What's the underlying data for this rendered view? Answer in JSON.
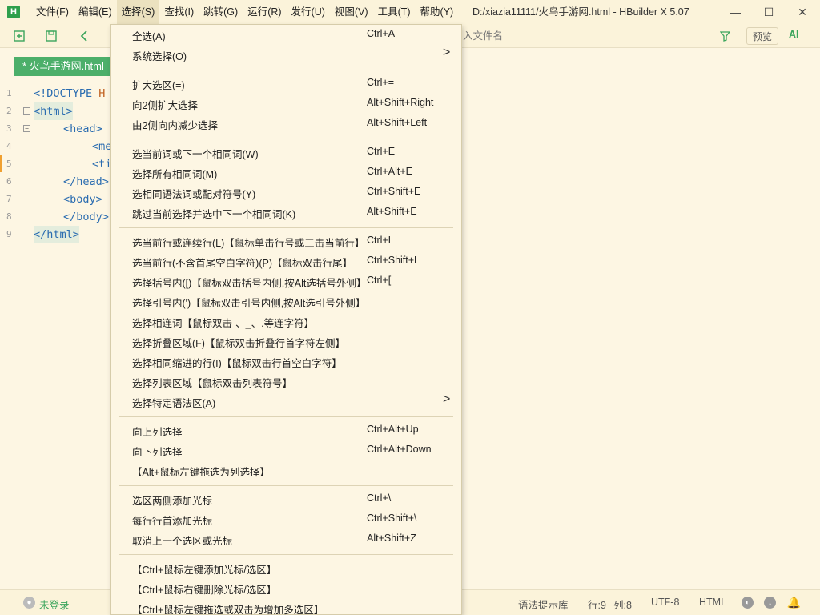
{
  "app": {
    "logo": "H",
    "window_title": "D:/xiazia11111/火鸟手游网.html - HBuilder X 5.07"
  },
  "menubar": [
    "文件(F)",
    "编辑(E)",
    "选择(S)",
    "查找(I)",
    "跳转(G)",
    "运行(R)",
    "发行(U)",
    "视图(V)",
    "工具(T)",
    "帮助(Y)"
  ],
  "window_controls": {
    "minimize": "—",
    "maximize": "☐",
    "close": "✕"
  },
  "toolbar": {
    "search_placeholder": "入文件名",
    "preview_label": "预览",
    "ai_label": "AI"
  },
  "tab": {
    "label": "* 火鸟手游网.html"
  },
  "editor": {
    "lines": [
      {
        "num": "1",
        "text": "<!DOCTYPE ",
        "tail": "H"
      },
      {
        "num": "2",
        "text": "<html>",
        "tail": ""
      },
      {
        "num": "3",
        "text": "<head>",
        "tail": ""
      },
      {
        "num": "4",
        "text": "<me",
        "tail": ""
      },
      {
        "num": "5",
        "text": "<ti",
        "tail": ""
      },
      {
        "num": "6",
        "text": "</head>",
        "tail": ""
      },
      {
        "num": "7",
        "text": "<body>",
        "tail": ""
      },
      {
        "num": "8",
        "text": "</body>",
        "tail": ""
      },
      {
        "num": "9",
        "text": "</html>",
        "tail": ""
      }
    ]
  },
  "selection_menu": {
    "items": [
      {
        "label": "全选(A)",
        "shortcut": "Ctrl+A"
      },
      {
        "label": "系统选择(O)",
        "shortcut": "",
        "submenu": ">"
      },
      {
        "label": "扩大选区(=)",
        "shortcut": "Ctrl+="
      },
      {
        "label": "向2侧扩大选择",
        "shortcut": "Alt+Shift+Right"
      },
      {
        "label": "由2侧向内减少选择",
        "shortcut": "Alt+Shift+Left"
      },
      {
        "label": "选当前词或下一个相同词(W)",
        "shortcut": "Ctrl+E"
      },
      {
        "label": "选择所有相同词(M)",
        "shortcut": "Ctrl+Alt+E"
      },
      {
        "label": "选相同语法词或配对符号(Y)",
        "shortcut": "Ctrl+Shift+E"
      },
      {
        "label": "跳过当前选择并选中下一个相同词(K)",
        "shortcut": "Alt+Shift+E"
      },
      {
        "label": "选当前行或连续行(L)【鼠标单击行号或三击当前行】",
        "shortcut": "Ctrl+L"
      },
      {
        "label": "选当前行(不含首尾空白字符)(P)【鼠标双击行尾】",
        "shortcut": "Ctrl+Shift+L"
      },
      {
        "label": "选择括号内([)【鼠标双击括号内侧,按Alt选括号外侧】",
        "shortcut": "Ctrl+["
      },
      {
        "label": "选择引号内(')【鼠标双击引号内侧,按Alt选引号外侧】",
        "shortcut": ""
      },
      {
        "label": "选择相连词【鼠标双击-、_、.等连字符】",
        "shortcut": ""
      },
      {
        "label": "选择折叠区域(F)【鼠标双击折叠行首字符左侧】",
        "shortcut": ""
      },
      {
        "label": "选择相同缩进的行(I)【鼠标双击行首空白字符】",
        "shortcut": ""
      },
      {
        "label": "选择列表区域【鼠标双击列表符号】",
        "shortcut": ""
      },
      {
        "label": "选择特定语法区(A)",
        "shortcut": "",
        "submenu": ">"
      },
      {
        "label": "向上列选择",
        "shortcut": "Ctrl+Alt+Up"
      },
      {
        "label": "向下列选择",
        "shortcut": "Ctrl+Alt+Down"
      },
      {
        "label": "【Alt+鼠标左键拖选为列选择】",
        "shortcut": ""
      },
      {
        "label": "选区两侧添加光标",
        "shortcut": "Ctrl+\\"
      },
      {
        "label": "每行行首添加光标",
        "shortcut": "Ctrl+Shift+\\"
      },
      {
        "label": "取消上一个选区或光标",
        "shortcut": "Alt+Shift+Z"
      },
      {
        "label": "【Ctrl+鼠标左键添加光标/选区】",
        "shortcut": ""
      },
      {
        "label": "【Ctrl+鼠标右键删除光标/选区】",
        "shortcut": ""
      },
      {
        "label": "【Ctrl+鼠标左键拖选或双击为增加多选区】",
        "shortcut": ""
      }
    ]
  },
  "statusbar": {
    "login": "未登录",
    "syntax_lib": "语法提示库",
    "line": "行:9",
    "col": "列:8",
    "encoding": "UTF-8",
    "language": "HTML"
  },
  "colors": {
    "accent": "#3ba55c",
    "tab_bg": "#4caf6a",
    "editor_bg": "#fdf6e3"
  }
}
